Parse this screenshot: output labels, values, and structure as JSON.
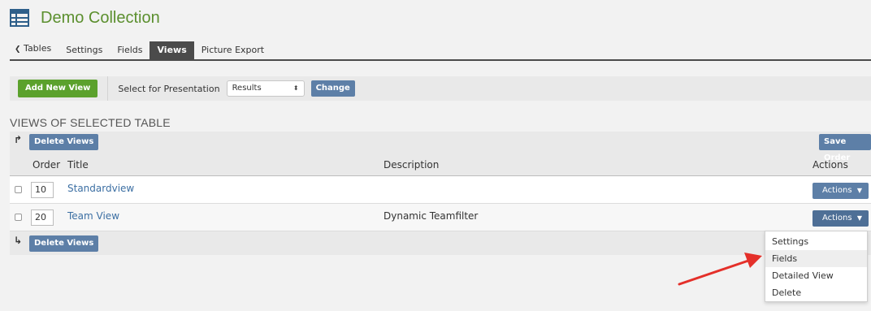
{
  "header": {
    "title": "Demo Collection",
    "icon": "table-icon"
  },
  "tabs": [
    {
      "label": "Tables",
      "icon": "chevron-left-icon"
    },
    {
      "label": "Settings"
    },
    {
      "label": "Fields"
    },
    {
      "label": "Views",
      "active": true
    },
    {
      "label": "Picture Export"
    }
  ],
  "toolbar": {
    "add_label": "Add New View",
    "select_label": "Select for Presentation",
    "select_value": "Results",
    "change_label": "Change"
  },
  "section_title": "VIEWS OF SELECTED TABLE",
  "panel": {
    "delete_views_label": "Delete Views",
    "save_order_label": "Save Order",
    "columns": {
      "order": "Order",
      "title": "Title",
      "description": "Description",
      "actions": "Actions"
    },
    "rows": [
      {
        "order": "10",
        "title": "Standardview",
        "description": "",
        "actions": "Actions"
      },
      {
        "order": "20",
        "title": "Team View",
        "description": "Dynamic Teamfilter",
        "actions": "Actions"
      }
    ]
  },
  "dropdown": {
    "items": [
      "Settings",
      "Fields",
      "Detailed View",
      "Delete"
    ],
    "highlighted": "Fields"
  },
  "colors": {
    "green": "#5ba12c",
    "blue": "#5d7fa7",
    "title_green": "#5b8f2e",
    "link_blue": "#3c6fa3",
    "annotation_red": "#e4302a"
  }
}
